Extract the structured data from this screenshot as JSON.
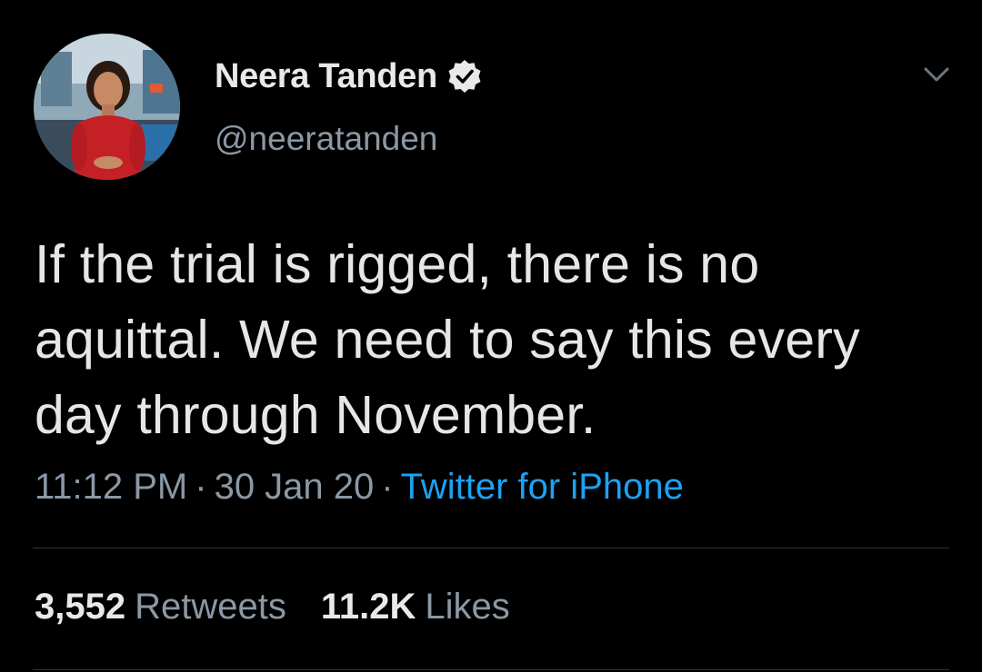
{
  "author": {
    "display_name": "Neera Tanden",
    "handle": "@neeratanden",
    "verified": true
  },
  "tweet": {
    "text": "If the trial is rigged, there is no\naquittal. We need to say this every\nday through November.",
    "time": "11:12 PM",
    "date": "30 Jan 20",
    "separator": "·",
    "source": "Twitter for iPhone"
  },
  "stats": {
    "retweets_count": "3,552",
    "retweets_label": "Retweets",
    "likes_count": "11.2K",
    "likes_label": "Likes"
  },
  "icons": {
    "verified": "verified-badge-icon",
    "menu": "chevron-down-icon"
  },
  "colors": {
    "background": "#000000",
    "text": "#e6e6e6",
    "secondary": "#8b98a5",
    "link": "#1da1f2",
    "divider": "#2f3336"
  }
}
